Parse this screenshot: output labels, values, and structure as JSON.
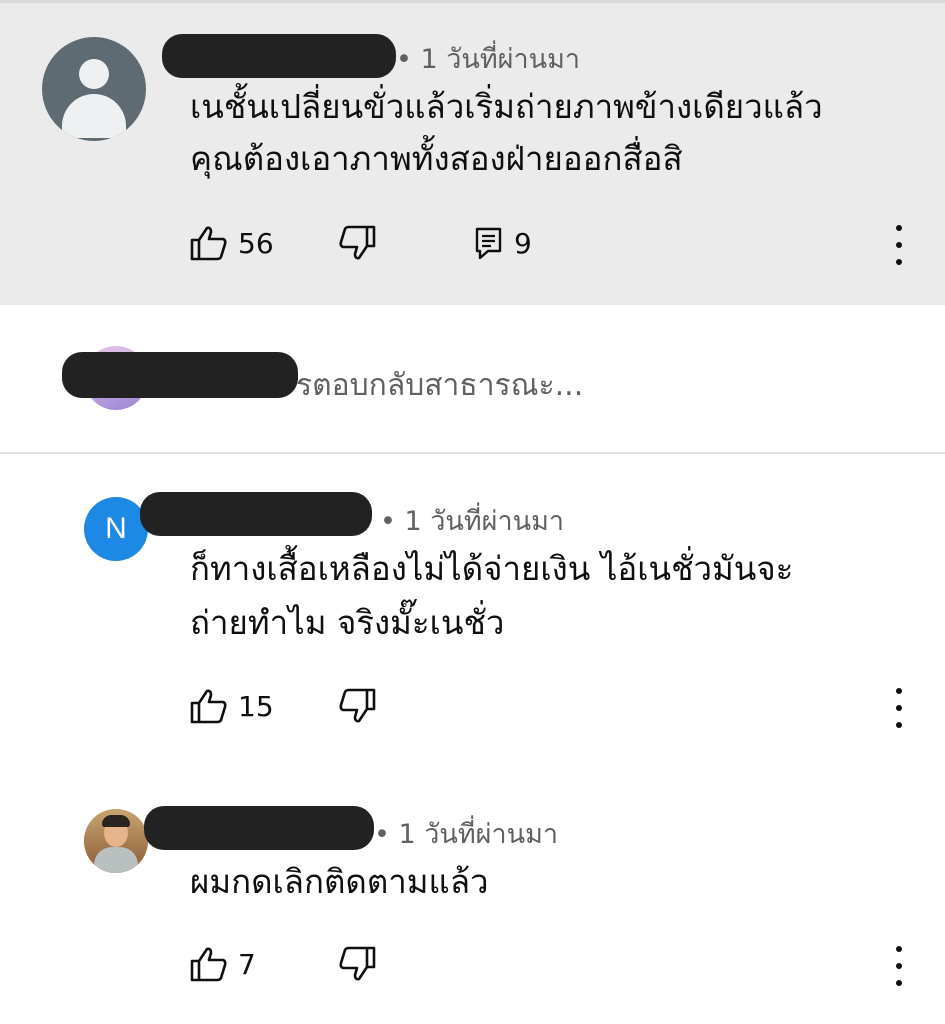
{
  "comment": {
    "time": "• 1 วันที่ผ่านมา",
    "line1": "เนชั้นเปลี่ยนขั่วแล้วเริ่มถ่ายภาพข้างเดียวแล้ว",
    "line2": "คุณต้องเอาภาพทั้งสองฝ่ายออกสื่อสิ",
    "likes": "56",
    "replies": "9",
    "icons": {
      "like": "thumbs-up-icon",
      "dislike": "thumbs-down-icon",
      "reply": "reply-icon",
      "more": "more-vert-icon",
      "avatar": "default-avatar-icon"
    }
  },
  "reply_input": {
    "placeholder": "รตอบกลับสาธารณะ..."
  },
  "replies": [
    {
      "avatar_letter": "N",
      "avatar_color": "#1e88e5",
      "time": "• 1 วันที่ผ่านมา",
      "line1": "ก็ทางเสื้อเหลืองไม่ได้จ่ายเงิน ไอ้เนชั่วมันจะ",
      "line2": "ถ่ายทำไม จริงมั๊ะเนชั่ว",
      "likes": "15"
    },
    {
      "time": "• 1 วันที่ผ่านมา",
      "line1": "ผมกดเลิกติดตามแล้ว",
      "likes": "7"
    }
  ],
  "colors": {
    "highlight_bg": "#ebebeb",
    "meta_text": "#606060",
    "redaction": "#222222"
  }
}
